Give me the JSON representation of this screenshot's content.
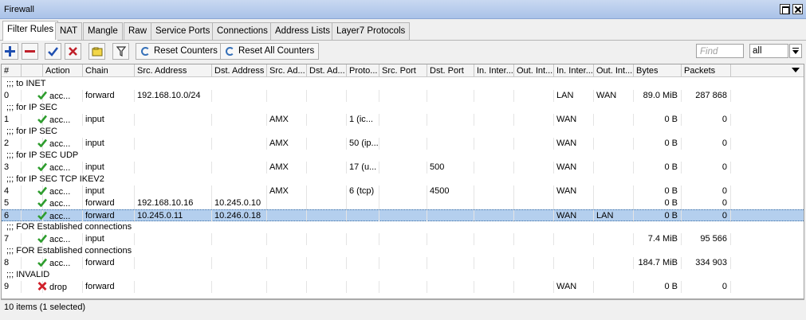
{
  "window": {
    "title": "Firewall"
  },
  "tabs": [
    "Filter Rules",
    "NAT",
    "Mangle",
    "Raw",
    "Service Ports",
    "Connections",
    "Address Lists",
    "Layer7 Protocols"
  ],
  "toolbar": {
    "reset_counters": "Reset Counters",
    "reset_all_counters": "Reset All Counters",
    "find_placeholder": "Find",
    "scope_value": "all"
  },
  "columns": [
    "#",
    "",
    "Action",
    "Chain",
    "Src. Address",
    "Dst. Address",
    "Src. Ad...",
    "Dst. Ad...",
    "Proto...",
    "Src. Port",
    "Dst. Port",
    "In. Inter...",
    "Out. Int...",
    "In. Inter...",
    "Out. Int...",
    "Bytes",
    "Packets"
  ],
  "rows": [
    {
      "type": "comment",
      "text": ";;; to INET"
    },
    {
      "type": "rule",
      "num": "0",
      "icon": "check",
      "action": "acc...",
      "chain": "forward",
      "src": "192.168.10.0/24",
      "dst": "",
      "srcal": "",
      "dstal": "",
      "proto": "",
      "sport": "",
      "dport": "",
      "inif1": "",
      "outif1": "",
      "inif2": "LAN",
      "outif2": "WAN",
      "bytes": "89.0 MiB",
      "packets": "287 868"
    },
    {
      "type": "comment",
      "text": ";;; for IP SEC"
    },
    {
      "type": "rule",
      "num": "1",
      "icon": "check",
      "action": "acc...",
      "chain": "input",
      "src": "",
      "dst": "",
      "srcal": "AMX",
      "dstal": "",
      "proto": "1 (ic...",
      "sport": "",
      "dport": "",
      "inif1": "",
      "outif1": "",
      "inif2": "WAN",
      "outif2": "",
      "bytes": "0 B",
      "packets": "0"
    },
    {
      "type": "comment",
      "text": ";;; for IP SEC"
    },
    {
      "type": "rule",
      "num": "2",
      "icon": "check",
      "action": "acc...",
      "chain": "input",
      "src": "",
      "dst": "",
      "srcal": "AMX",
      "dstal": "",
      "proto": "50 (ip...",
      "sport": "",
      "dport": "",
      "inif1": "",
      "outif1": "",
      "inif2": "WAN",
      "outif2": "",
      "bytes": "0 B",
      "packets": "0"
    },
    {
      "type": "comment",
      "text": ";;; for IP SEC UDP"
    },
    {
      "type": "rule",
      "num": "3",
      "icon": "check",
      "action": "acc...",
      "chain": "input",
      "src": "",
      "dst": "",
      "srcal": "AMX",
      "dstal": "",
      "proto": "17 (u...",
      "sport": "",
      "dport": "500",
      "inif1": "",
      "outif1": "",
      "inif2": "WAN",
      "outif2": "",
      "bytes": "0 B",
      "packets": "0"
    },
    {
      "type": "comment",
      "text": ";;; for IP SEC TCP IKEV2"
    },
    {
      "type": "rule",
      "num": "4",
      "icon": "check",
      "action": "acc...",
      "chain": "input",
      "src": "",
      "dst": "",
      "srcal": "AMX",
      "dstal": "",
      "proto": "6 (tcp)",
      "sport": "",
      "dport": "4500",
      "inif1": "",
      "outif1": "",
      "inif2": "WAN",
      "outif2": "",
      "bytes": "0 B",
      "packets": "0"
    },
    {
      "type": "rule",
      "num": "5",
      "icon": "check",
      "action": "acc...",
      "chain": "forward",
      "src": "192.168.10.16",
      "dst": "10.245.0.10",
      "srcal": "",
      "dstal": "",
      "proto": "",
      "sport": "",
      "dport": "",
      "inif1": "",
      "outif1": "",
      "inif2": "",
      "outif2": "",
      "bytes": "0 B",
      "packets": "0"
    },
    {
      "type": "rule",
      "selected": true,
      "num": "6",
      "icon": "check",
      "action": "acc...",
      "chain": "forward",
      "src": "10.245.0.11",
      "dst": "10.246.0.18",
      "srcal": "",
      "dstal": "",
      "proto": "",
      "sport": "",
      "dport": "",
      "inif1": "",
      "outif1": "",
      "inif2": "WAN",
      "outif2": "LAN",
      "bytes": "0 B",
      "packets": "0"
    },
    {
      "type": "comment",
      "text": ";;; FOR Established connections"
    },
    {
      "type": "rule",
      "num": "7",
      "icon": "check",
      "action": "acc...",
      "chain": "input",
      "src": "",
      "dst": "",
      "srcal": "",
      "dstal": "",
      "proto": "",
      "sport": "",
      "dport": "",
      "inif1": "",
      "outif1": "",
      "inif2": "",
      "outif2": "",
      "bytes": "7.4 MiB",
      "packets": "95 566"
    },
    {
      "type": "comment",
      "text": ";;; FOR Established connections"
    },
    {
      "type": "rule",
      "num": "8",
      "icon": "check",
      "action": "acc...",
      "chain": "forward",
      "src": "",
      "dst": "",
      "srcal": "",
      "dstal": "",
      "proto": "",
      "sport": "",
      "dport": "",
      "inif1": "",
      "outif1": "",
      "inif2": "",
      "outif2": "",
      "bytes": "184.7 MiB",
      "packets": "334 903"
    },
    {
      "type": "comment",
      "text": ";;; INVALID"
    },
    {
      "type": "rule",
      "num": "9",
      "icon": "cross",
      "action": "drop",
      "chain": "forward",
      "src": "",
      "dst": "",
      "srcal": "",
      "dstal": "",
      "proto": "",
      "sport": "",
      "dport": "",
      "inif1": "",
      "outif1": "",
      "inif2": "WAN",
      "outif2": "",
      "bytes": "0 B",
      "packets": "0"
    }
  ],
  "status": "10 items (1 selected)",
  "colors": {
    "accept": "#2e9d2e",
    "drop": "#d0202a",
    "selected_row": "#b4cfee",
    "titlebar": "#b9cdef"
  }
}
